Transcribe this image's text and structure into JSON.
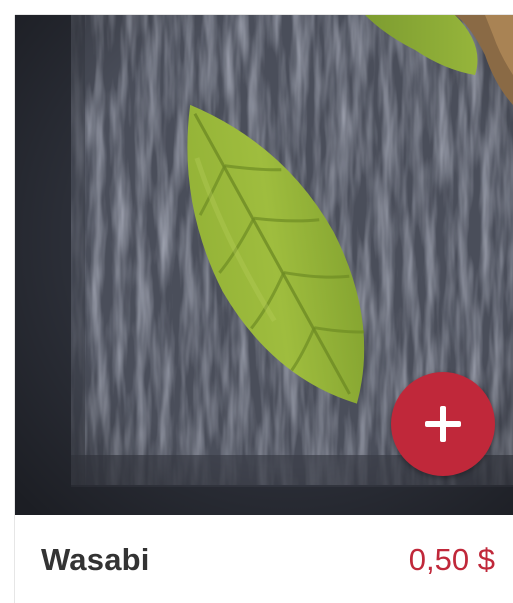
{
  "product": {
    "name": "Wasabi",
    "price": "0,50 $",
    "add_action_icon": "plus-icon"
  },
  "colors": {
    "accent": "#c0283a",
    "background_slate": "#2a2d36",
    "name_text": "#333333"
  }
}
